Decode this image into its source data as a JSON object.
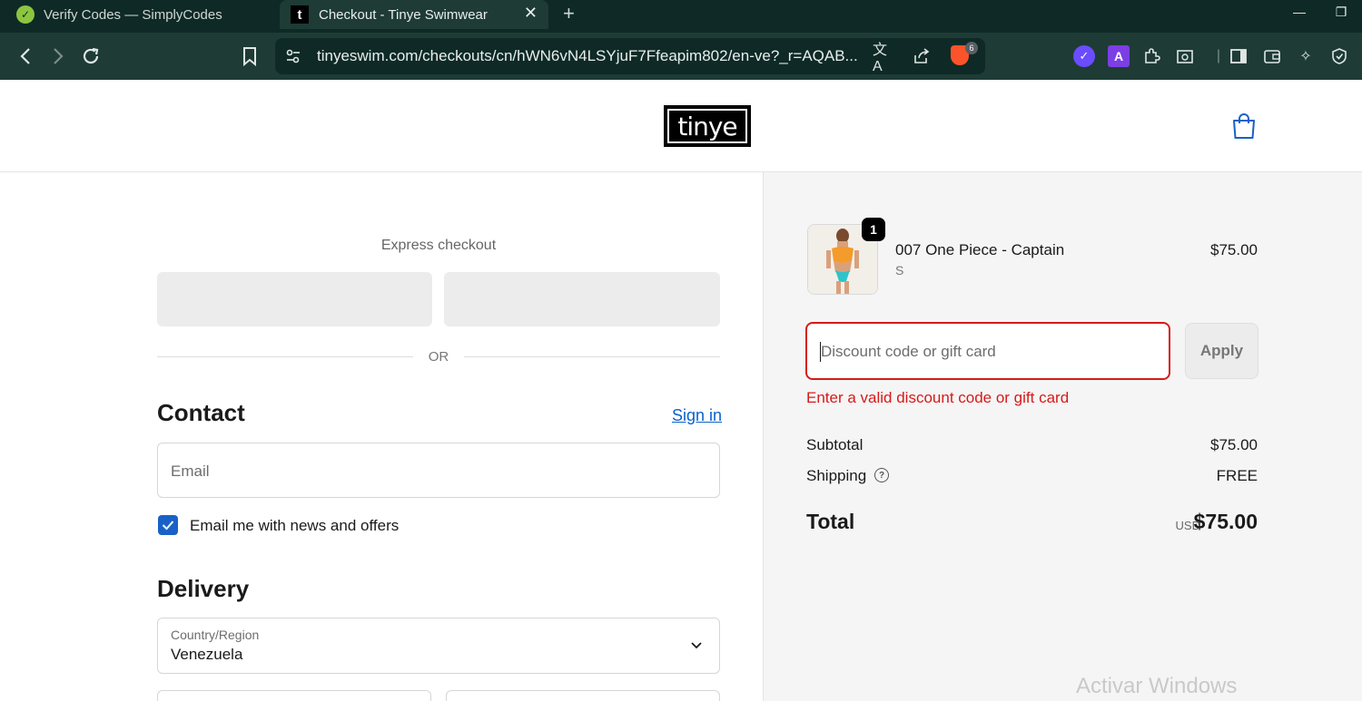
{
  "browser": {
    "tabs": [
      {
        "title": "Verify Codes — SimplyCodes",
        "active": false
      },
      {
        "title": "Checkout - Tinye Swimwear",
        "active": true
      }
    ],
    "url": "tinyeswim.com/checkouts/cn/hWN6vN4LSYjuF7Ffeapim802/en-ve?_r=AQAB...",
    "brave_badge_count": "6",
    "toolbar_colors": {
      "tabbar": "#0f2a26",
      "toolbar": "#1e3b36"
    }
  },
  "header": {
    "logo_text": "tinye"
  },
  "checkout": {
    "express_title": "Express checkout",
    "or_label": "OR",
    "contact": {
      "title": "Contact",
      "sign_in_label": "Sign in",
      "email_placeholder": "Email",
      "newsletter_label": "Email me with news and offers",
      "newsletter_checked": true
    },
    "delivery": {
      "title": "Delivery",
      "country_label": "Country/Region",
      "country_value": "Venezuela"
    }
  },
  "summary": {
    "item": {
      "name": "007 One Piece - Captain",
      "variant": "S",
      "price": "$75.00",
      "quantity": "1"
    },
    "discount_placeholder": "Discount code or gift card",
    "apply_label": "Apply",
    "error_message": "Enter a valid discount code or gift card",
    "subtotal_label": "Subtotal",
    "subtotal_value": "$75.00",
    "shipping_label": "Shipping",
    "shipping_value": "FREE",
    "total_label": "Total",
    "total_currency": "USD",
    "total_value": "$75.00"
  },
  "os_watermark": "Activar Windows",
  "colors": {
    "accent_blue": "#1961c8",
    "link_blue": "#0a62c9",
    "error_red": "#d61a1a"
  }
}
